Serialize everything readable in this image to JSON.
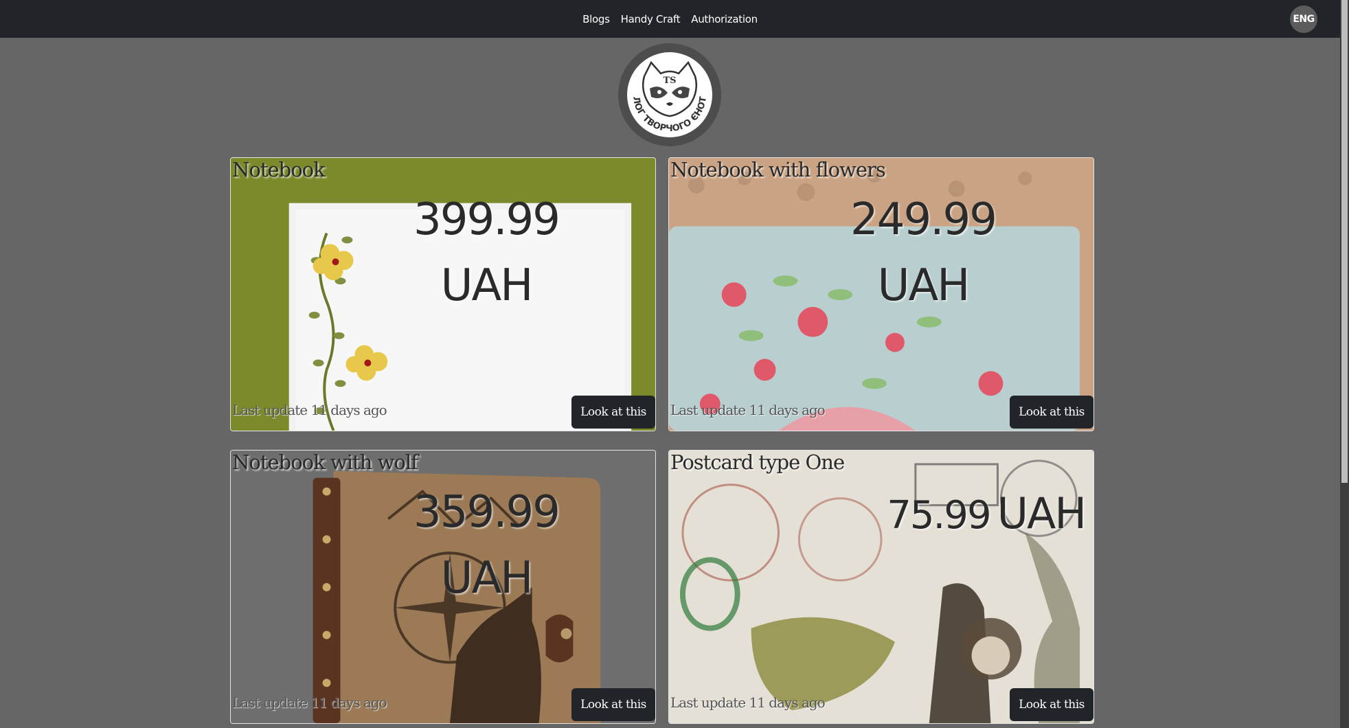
{
  "nav": {
    "links": [
      "Blogs",
      "Handy Craft",
      "Authorization"
    ],
    "language": "ENG"
  },
  "logo": {
    "initials": "TS",
    "ring_text": "\"БЛОГ ТВОРЧОГО ЄНОТА\""
  },
  "cards": [
    {
      "title": "Notebook",
      "price": "399.99",
      "currency": "UAH",
      "updated": "Last update 11 days ago",
      "button": "Look at this"
    },
    {
      "title": "Notebook with flowers",
      "price": "249.99",
      "currency": "UAH",
      "updated": "Last update 11 days ago",
      "button": "Look at this"
    },
    {
      "title": "Notebook with wolf",
      "price": "359.99",
      "currency": "UAH",
      "updated": "Last update 11 days ago",
      "button": "Look at this"
    },
    {
      "title": "Postcard type One",
      "price": "75.99",
      "currency": "UAH",
      "updated": "Last update 11 days ago",
      "button": "Look at this"
    }
  ]
}
